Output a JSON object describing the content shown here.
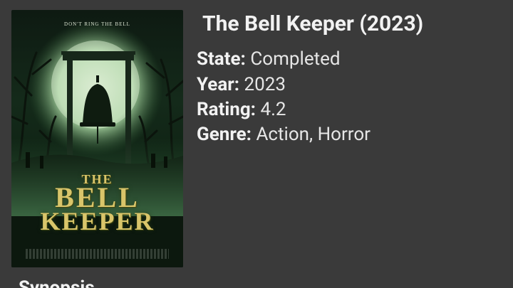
{
  "poster": {
    "tagline": "DON'T RING THE BELL",
    "title_line1": "THE",
    "title_line2": "BELL",
    "title_line3": "KEEPER"
  },
  "detail": {
    "title": "The Bell Keeper (2023)",
    "state_label": "State:",
    "state_value": "Completed",
    "year_label": "Year:",
    "year_value": "2023",
    "rating_label": "Rating:",
    "rating_value": "4.2",
    "genre_label": "Genre:",
    "genre_value": "Action, Horror"
  },
  "synopsis": {
    "heading": "Synopsis"
  },
  "colors": {
    "background": "#3a3a3a",
    "text": "#f2f2f2",
    "poster_title": "#d9c56a"
  }
}
